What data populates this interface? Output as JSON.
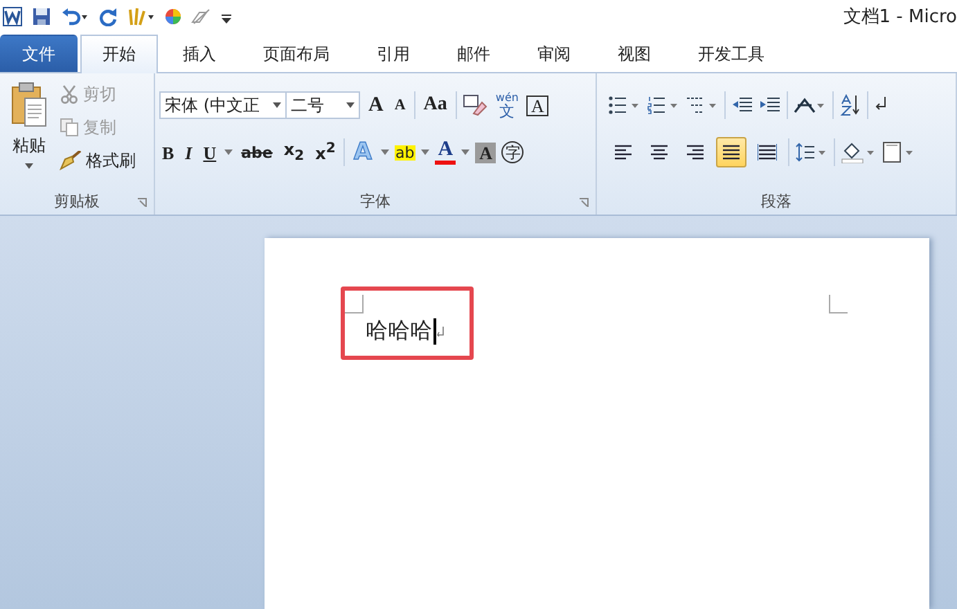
{
  "title_bar": {
    "title": "文档1 - Micro"
  },
  "tabs": [
    {
      "label": "文件",
      "kind": "file",
      "selected": false
    },
    {
      "label": "开始",
      "kind": "tab",
      "selected": true
    },
    {
      "label": "插入",
      "kind": "tab",
      "selected": false
    },
    {
      "label": "页面布局",
      "kind": "tab",
      "selected": false
    },
    {
      "label": "引用",
      "kind": "tab",
      "selected": false
    },
    {
      "label": "邮件",
      "kind": "tab",
      "selected": false
    },
    {
      "label": "审阅",
      "kind": "tab",
      "selected": false
    },
    {
      "label": "视图",
      "kind": "tab",
      "selected": false
    },
    {
      "label": "开发工具",
      "kind": "tab",
      "selected": false
    }
  ],
  "clipboard": {
    "paste": "粘贴",
    "cut": "剪切",
    "copy": "复制",
    "format_painter": "格式刷",
    "label": "剪贴板"
  },
  "font": {
    "name": "宋体 (中文正",
    "size": "二号",
    "grow": "A",
    "shrink": "A",
    "change_case": "Aa",
    "phonetic_top": "wén",
    "phonetic_bottom": "文",
    "border_char": "A",
    "label": "字体",
    "format_buttons": [
      {
        "kind": "bold",
        "text": "B"
      },
      {
        "kind": "italic",
        "text": "I"
      },
      {
        "kind": "underline",
        "text": "U"
      },
      {
        "kind": "strike",
        "text": "abe"
      },
      {
        "kind": "sub",
        "text": "x$_{2}$"
      },
      {
        "kind": "sup",
        "text": "x$^{2}$"
      }
    ],
    "effects": "A",
    "highlight": "ab",
    "font_color": "A",
    "shading": "A",
    "enclose": "字"
  },
  "paragraph": {
    "label": "段落",
    "alignment": [
      {
        "kind": "left",
        "selected": false
      },
      {
        "kind": "center",
        "selected": false
      },
      {
        "kind": "right",
        "selected": false
      },
      {
        "kind": "justify",
        "selected": true
      },
      {
        "kind": "distributed",
        "selected": false
      }
    ]
  },
  "document": {
    "text": "哈哈哈"
  }
}
